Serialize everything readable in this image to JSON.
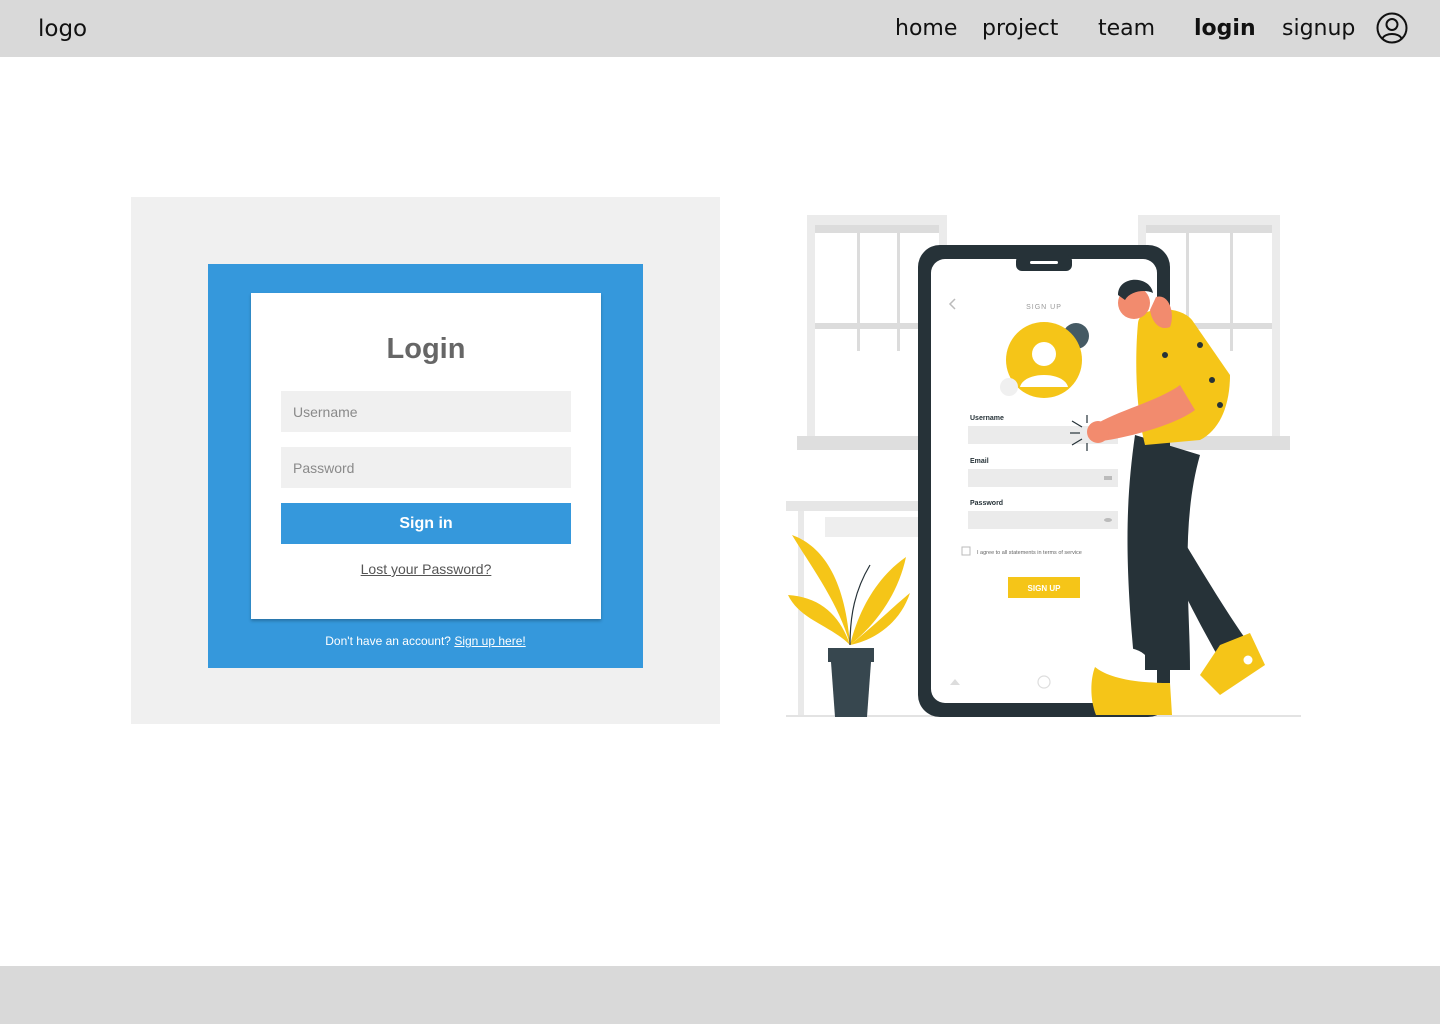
{
  "nav": {
    "logo": "logo",
    "links": [
      {
        "label": "home"
      },
      {
        "label": "project"
      },
      {
        "label": "team"
      },
      {
        "label": "login"
      },
      {
        "label": "signup"
      }
    ],
    "user_icon": "user-circle-icon"
  },
  "login": {
    "title": "Login",
    "username_placeholder": "Username",
    "password_placeholder": "Password",
    "signin_label": "Sign in",
    "lost_password": "Lost your Password?",
    "no_account_text": "Don't have an account?",
    "signup_link": "Sign up here!"
  },
  "illustration": {
    "screen_title": "SIGN UP",
    "username_label": "Username",
    "email_label": "Email",
    "password_label": "Password",
    "agree_text": "I agree to all statements in terms of service",
    "button_label": "SIGN UP"
  },
  "colors": {
    "accent_blue": "#3598dc",
    "illustration_yellow": "#f5c518",
    "illustration_dark": "#263238"
  }
}
